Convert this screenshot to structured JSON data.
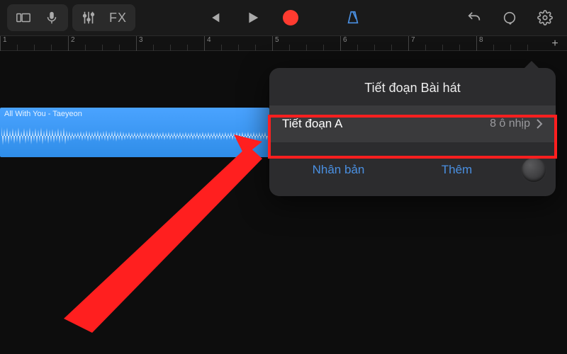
{
  "toolbar": {
    "fx_label": "FX"
  },
  "ruler": {
    "bars": [
      "1",
      "2",
      "3",
      "4",
      "5",
      "6",
      "7",
      "8"
    ],
    "add_label": "+"
  },
  "clip": {
    "title": "All With You - Taeyeon"
  },
  "popover": {
    "title": "Tiết đoạn Bài hát",
    "row": {
      "label": "Tiết đoạn A",
      "value": "8 ô nhịp"
    },
    "actions": {
      "duplicate": "Nhân bản",
      "add": "Thêm"
    }
  }
}
